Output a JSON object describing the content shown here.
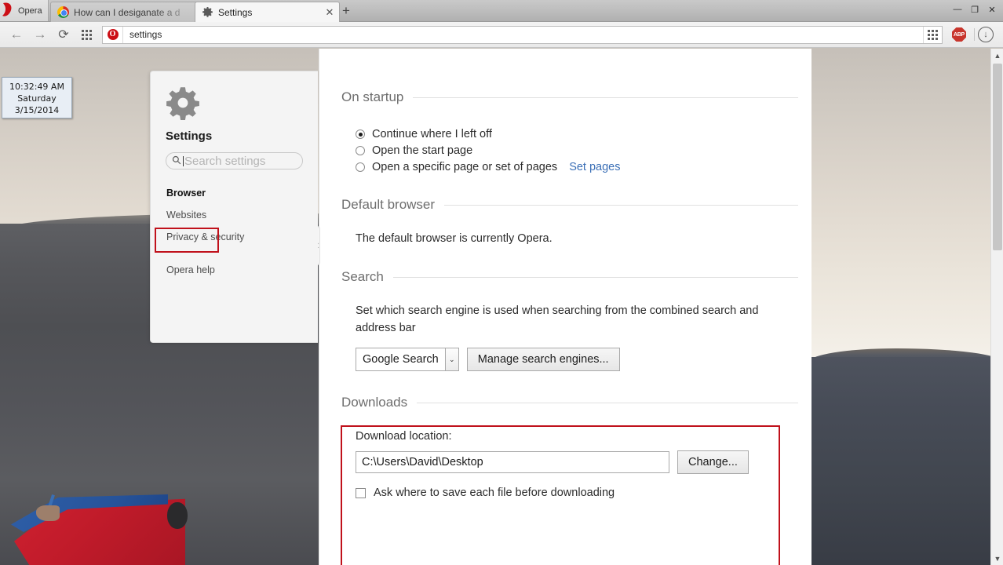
{
  "window": {
    "opera_menu_label": "Opera",
    "opera_glyph": "O",
    "controls": {
      "minimize": "—",
      "restore": "❐",
      "close": "✕"
    }
  },
  "tabs": [
    {
      "title": "How can I desiganate a d",
      "close": "✕",
      "favicon": "chrome-favicon",
      "active": false
    },
    {
      "title": "Settings",
      "close": "✕",
      "favicon": "gear-icon",
      "active": true
    }
  ],
  "new_tab_label": "+",
  "toolbar": {
    "back": "←",
    "forward": "→",
    "reload": "⟳",
    "speeddial": "speed-dial-icon",
    "address_value": "settings",
    "address_badge": "O",
    "abp_label": "ABP",
    "download_glyph": "↓"
  },
  "desktop": {
    "clock": {
      "time": "10:32:49 AM",
      "day": "Saturday",
      "date": "3/15/2014"
    }
  },
  "sidebar": {
    "title": "Settings",
    "search_placeholder": "Search settings",
    "collapse_glyph": "«",
    "items": [
      {
        "label": "Browser",
        "selected": true
      },
      {
        "label": "Websites",
        "selected": false
      },
      {
        "label": "Privacy & security",
        "selected": false
      },
      {
        "label": "Opera help",
        "selected": false
      }
    ]
  },
  "settings": {
    "startup": {
      "heading": "On startup",
      "options": [
        {
          "label": "Continue where I left off",
          "checked": true
        },
        {
          "label": "Open the start page",
          "checked": false
        },
        {
          "label": "Open a specific page or set of pages",
          "checked": false,
          "link": "Set pages"
        }
      ]
    },
    "default_browser": {
      "heading": "Default browser",
      "status": "The default browser is currently Opera."
    },
    "search": {
      "heading": "Search",
      "description": "Set which search engine is used when searching from the combined search and address bar",
      "engine_value": "Google Search",
      "dropdown_glyph": "⌄",
      "manage_button": "Manage search engines..."
    },
    "downloads": {
      "heading": "Downloads",
      "location_label": "Download location:",
      "location_value": "C:\\Users\\David\\Desktop",
      "change_button": "Change...",
      "ask_label": "Ask where to save each file before downloading",
      "ask_checked": false
    }
  },
  "scrollbar": {
    "up": "▲",
    "down": "▼"
  },
  "colors": {
    "highlight_red": "#c0111b",
    "link_blue": "#3b6fb6",
    "opera_red": "#cc0f16",
    "section_gray": "#6e6e6e"
  }
}
